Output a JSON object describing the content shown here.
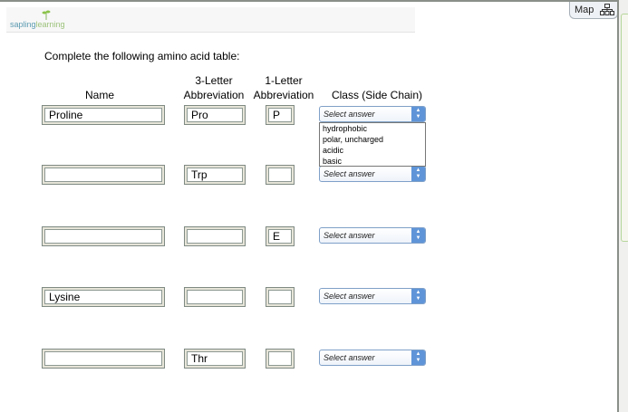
{
  "logo": {
    "part1": "sapling",
    "part2": "learning"
  },
  "map_button": "Map",
  "instruction": "Complete the following amino acid table:",
  "headers": {
    "name": "Name",
    "three_letter": [
      "3-Letter",
      "Abbreviation"
    ],
    "one_letter": [
      "1-Letter",
      "Abbreviation"
    ],
    "class": "Class (Side Chain)"
  },
  "rows": [
    {
      "name": "Proline",
      "three": "Pro",
      "one": "P",
      "class": "Select answer"
    },
    {
      "name": "",
      "three": "Trp",
      "one": "",
      "class": "Select answer"
    },
    {
      "name": "",
      "three": "",
      "one": "E",
      "class": "Select answer"
    },
    {
      "name": "Lysine",
      "three": "",
      "one": "",
      "class": "Select answer"
    },
    {
      "name": "",
      "three": "Thr",
      "one": "",
      "class": "Select answer"
    }
  ],
  "dropdown_options": [
    "hydrophobic",
    "polar, uncharged",
    "acidic",
    "basic"
  ]
}
